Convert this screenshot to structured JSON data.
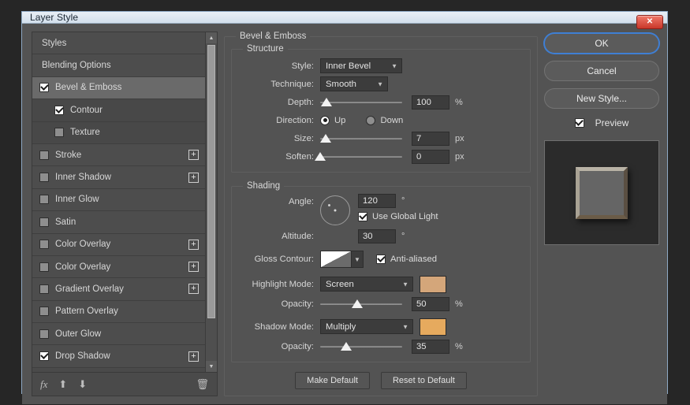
{
  "window": {
    "title": "Layer Style",
    "close_icon": "close-icon",
    "close_glyph": "✕"
  },
  "styles_panel": {
    "items": [
      {
        "label": "Styles",
        "type": "plain",
        "checkbox": null,
        "plus": false
      },
      {
        "label": "Blending Options",
        "type": "plain",
        "checkbox": null,
        "plus": false
      },
      {
        "label": "Bevel & Emboss",
        "type": "selected",
        "checkbox": true,
        "plus": false
      },
      {
        "label": "Contour",
        "type": "sub",
        "checkbox": true,
        "plus": false
      },
      {
        "label": "Texture",
        "type": "sub",
        "checkbox": false,
        "plus": false
      },
      {
        "label": "Stroke",
        "type": "normal",
        "checkbox": false,
        "plus": true
      },
      {
        "label": "Inner Shadow",
        "type": "normal",
        "checkbox": false,
        "plus": true
      },
      {
        "label": "Inner Glow",
        "type": "normal",
        "checkbox": false,
        "plus": false
      },
      {
        "label": "Satin",
        "type": "normal",
        "checkbox": false,
        "plus": false
      },
      {
        "label": "Color Overlay",
        "type": "normal",
        "checkbox": false,
        "plus": true
      },
      {
        "label": "Color Overlay",
        "type": "normal",
        "checkbox": false,
        "plus": true
      },
      {
        "label": "Gradient Overlay",
        "type": "normal",
        "checkbox": false,
        "plus": true
      },
      {
        "label": "Pattern Overlay",
        "type": "normal",
        "checkbox": false,
        "plus": false
      },
      {
        "label": "Outer Glow",
        "type": "normal",
        "checkbox": false,
        "plus": false
      },
      {
        "label": "Drop Shadow",
        "type": "normal",
        "checkbox": true,
        "plus": true
      }
    ],
    "plus_glyph": "+",
    "scroll": {
      "up_glyph": "▲",
      "down_glyph": "▼"
    },
    "toolbar": {
      "fx_label": "fx",
      "up_glyph": "⬆",
      "down_glyph": "⬇",
      "trash_glyph": "🗑"
    }
  },
  "settings": {
    "section_title": "Bevel & Emboss",
    "structure": {
      "title": "Structure",
      "style": {
        "label": "Style:",
        "value": "Inner Bevel"
      },
      "technique": {
        "label": "Technique:",
        "value": "Smooth"
      },
      "depth": {
        "label": "Depth:",
        "value": "100",
        "unit": "%",
        "percent": 8
      },
      "direction": {
        "label": "Direction:",
        "up_label": "Up",
        "down_label": "Down",
        "selected": "Up"
      },
      "size": {
        "label": "Size:",
        "value": "7",
        "unit": "px",
        "percent": 7
      },
      "soften": {
        "label": "Soften:",
        "value": "0",
        "unit": "px",
        "percent": 0
      }
    },
    "shading": {
      "title": "Shading",
      "angle": {
        "label": "Angle:",
        "value": "120",
        "unit": "°"
      },
      "use_global_light": {
        "label": "Use Global Light",
        "checked": true
      },
      "altitude": {
        "label": "Altitude:",
        "value": "30",
        "unit": "°"
      },
      "gloss_contour": {
        "label": "Gloss Contour:"
      },
      "anti_aliased": {
        "label": "Anti-aliased",
        "checked": true
      },
      "highlight_mode": {
        "label": "Highlight Mode:",
        "value": "Screen",
        "color": "#d4a67a"
      },
      "highlight_opacity": {
        "label": "Opacity:",
        "value": "50",
        "unit": "%",
        "percent": 45
      },
      "shadow_mode": {
        "label": "Shadow Mode:",
        "value": "Multiply",
        "color": "#e6aa5e"
      },
      "shadow_opacity": {
        "label": "Opacity:",
        "value": "35",
        "unit": "%",
        "percent": 32
      }
    },
    "make_default": "Make Default",
    "reset_to_default": "Reset to Default"
  },
  "actions": {
    "ok": "OK",
    "cancel": "Cancel",
    "new_style": "New Style...",
    "preview": {
      "label": "Preview",
      "checked": true
    }
  },
  "chevron_glyph": "▼"
}
